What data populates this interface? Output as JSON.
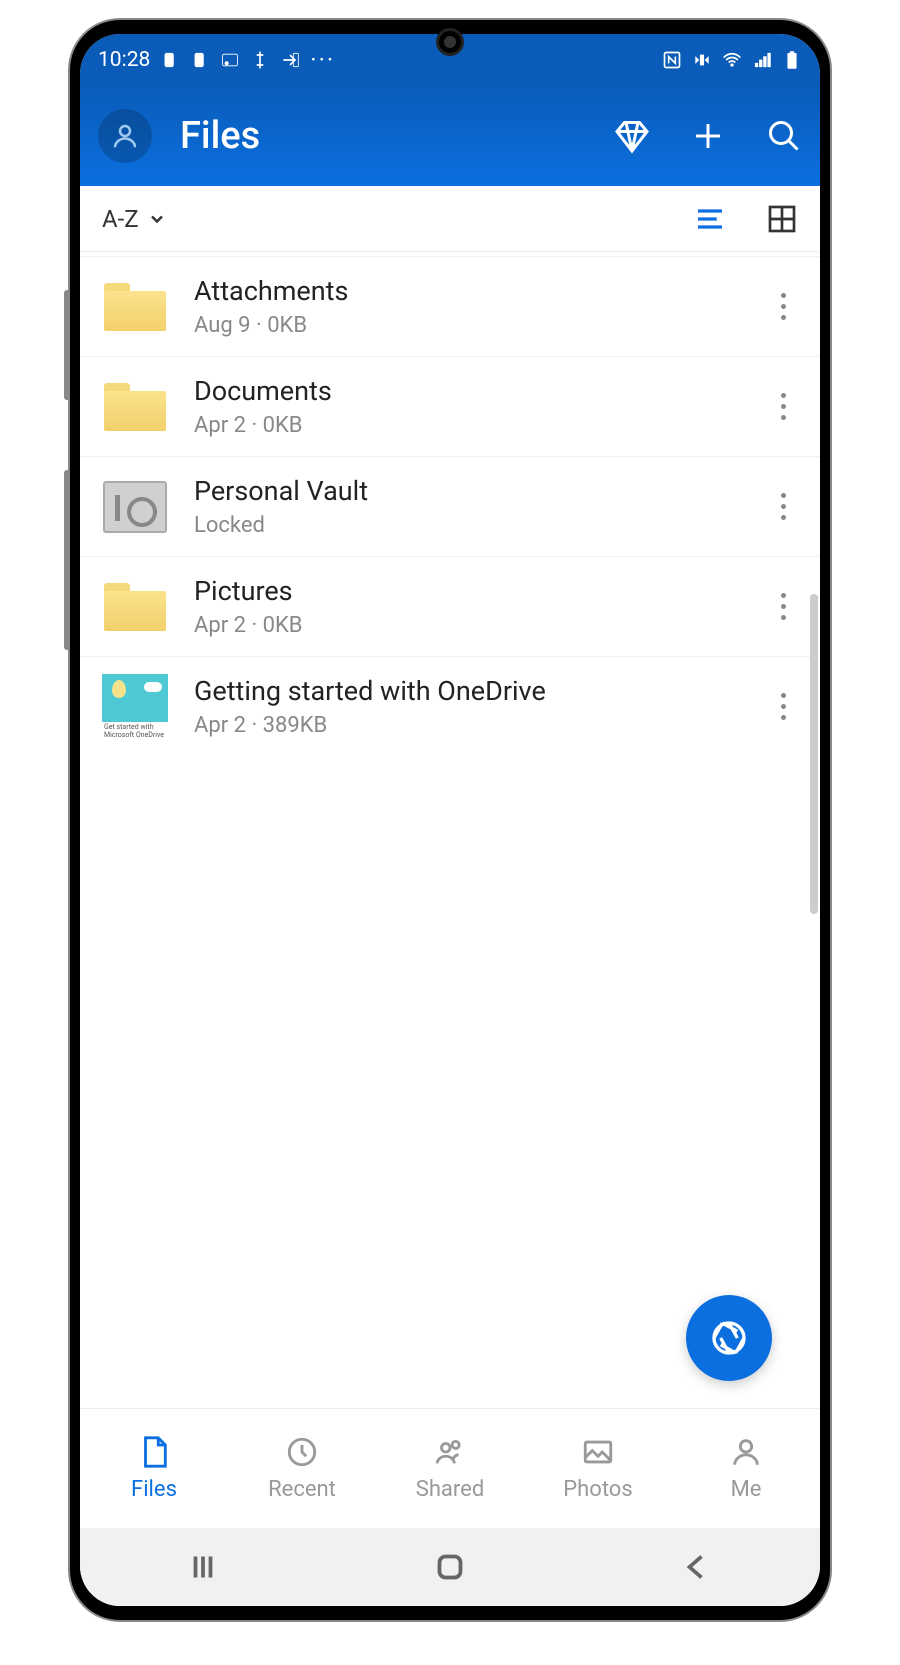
{
  "status_bar": {
    "time": "10:28",
    "more_dots": "···"
  },
  "header": {
    "title": "Files"
  },
  "sort": {
    "label": "A-Z"
  },
  "files": [
    {
      "name": "Attachments",
      "meta": "Aug 9 · 0KB",
      "type": "folder"
    },
    {
      "name": "Documents",
      "meta": "Apr 2 · 0KB",
      "type": "folder"
    },
    {
      "name": "Personal Vault",
      "meta": "Locked",
      "type": "vault"
    },
    {
      "name": "Pictures",
      "meta": "Apr 2 · 0KB",
      "type": "folder"
    },
    {
      "name": "Getting started with OneDrive",
      "meta": "Apr 2 · 389KB",
      "type": "doc"
    }
  ],
  "nav": {
    "files": "Files",
    "recent": "Recent",
    "shared": "Shared",
    "photos": "Photos",
    "me": "Me"
  },
  "doc_caption": "Get started with Microsoft OneDrive"
}
